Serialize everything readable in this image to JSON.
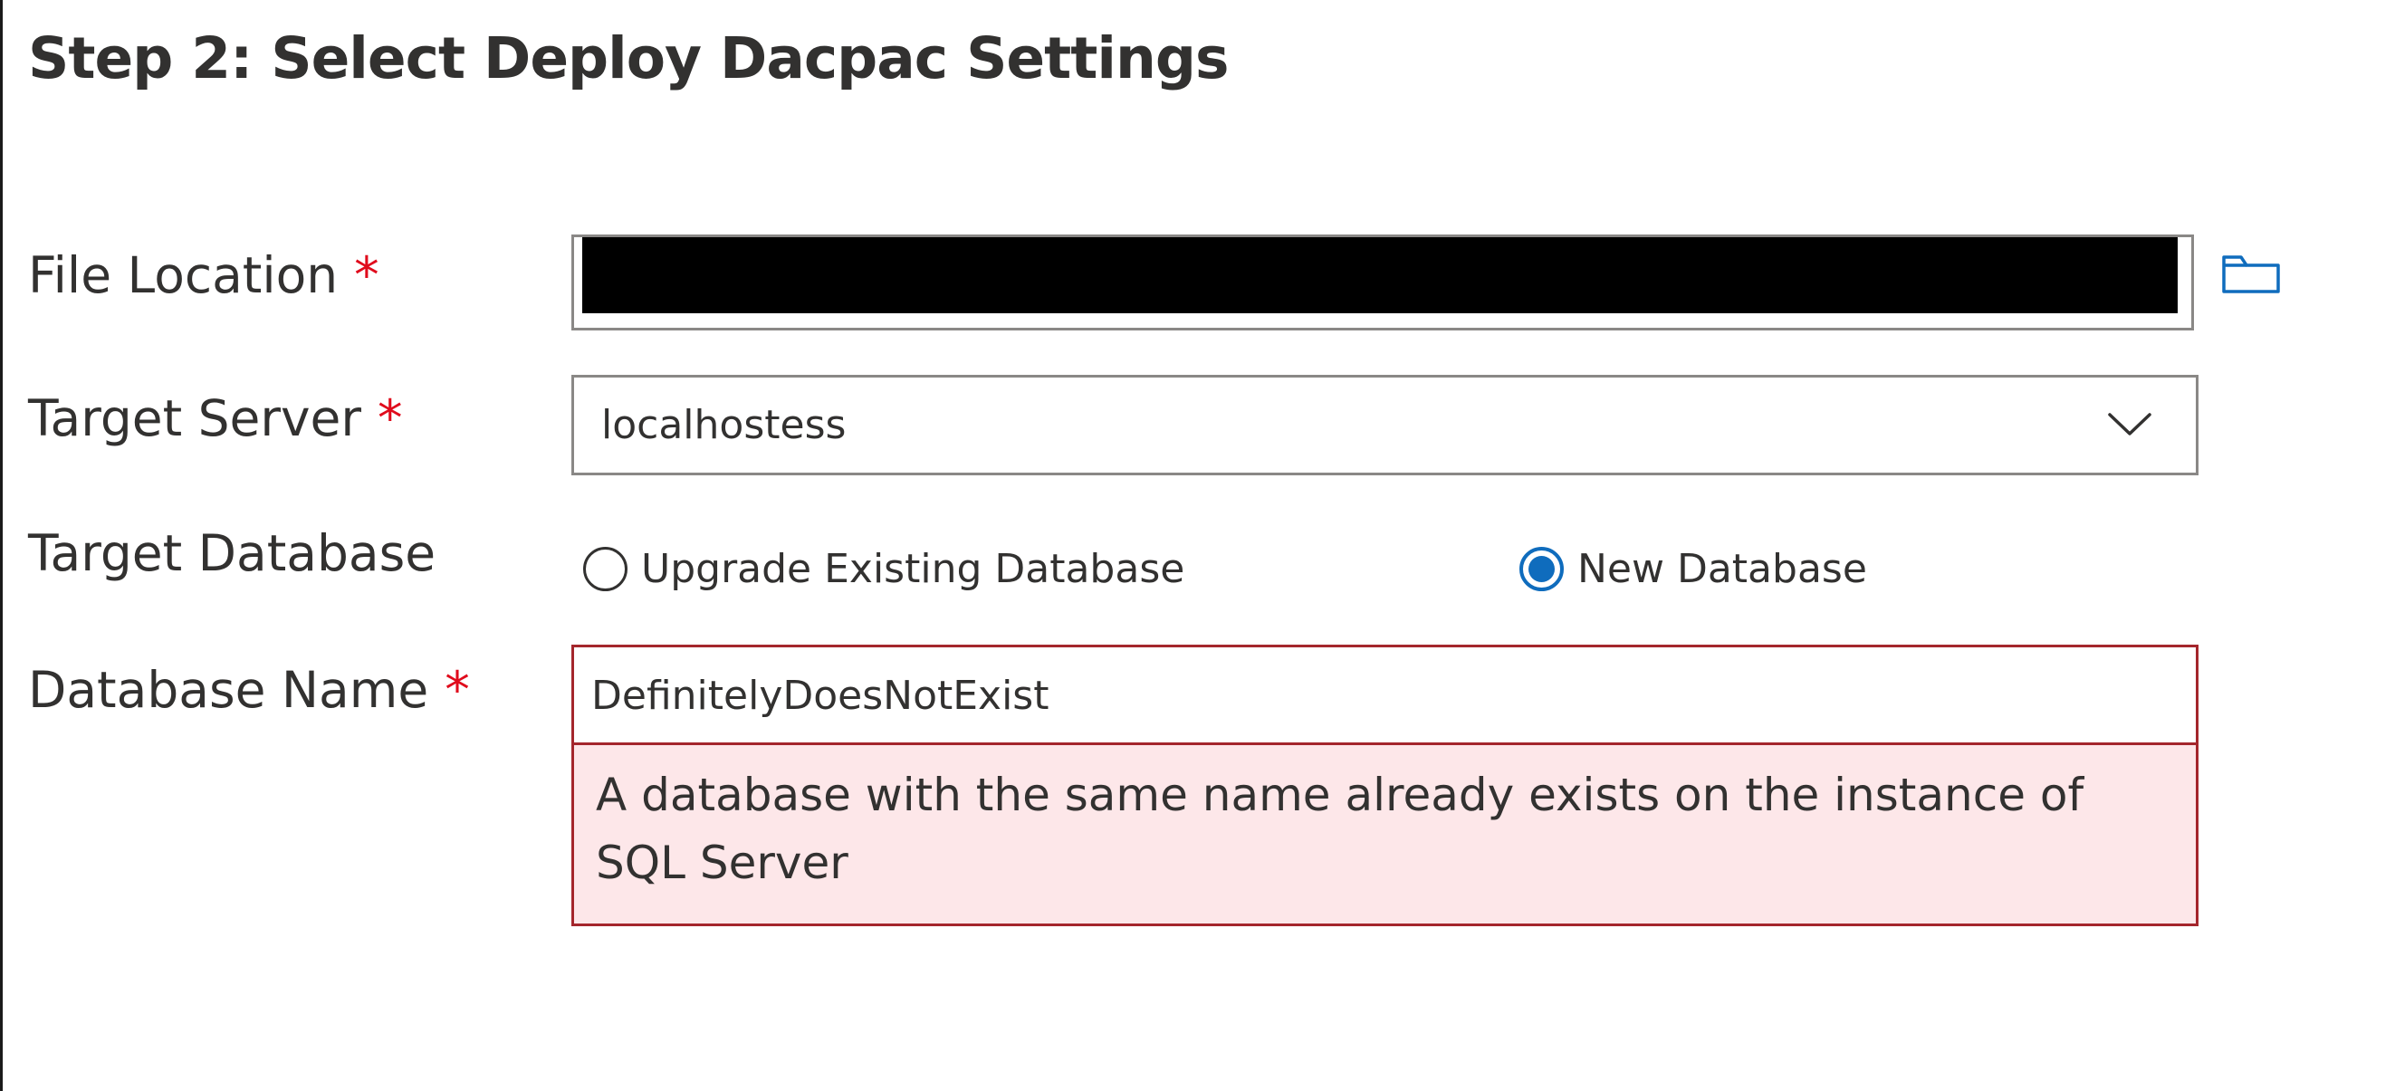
{
  "page": {
    "title": "Step 2: Select Deploy Dacpac Settings"
  },
  "form": {
    "file_location": {
      "label": "File Location",
      "required_mark": "*",
      "value": ""
    },
    "target_server": {
      "label": "Target Server",
      "required_mark": "*",
      "selected": "localhostess"
    },
    "target_database": {
      "label": "Target Database",
      "options": [
        {
          "label": "Upgrade Existing Database",
          "checked": false
        },
        {
          "label": "New Database",
          "checked": true
        }
      ]
    },
    "database_name": {
      "label": "Database Name",
      "required_mark": "*",
      "value": "DefinitelyDoesNotExist",
      "error": "A database with the same name already exists on the instance of SQL Server"
    }
  },
  "icons": {
    "browse": "folder-icon",
    "dropdown": "chevron-down-icon"
  },
  "colors": {
    "accent": "#0f6cbd",
    "required": "#e00b1c",
    "error_border": "#a4262c",
    "error_background": "#fde7e9",
    "text": "#323130",
    "input_border": "#8a8886",
    "redaction": "#000000"
  }
}
